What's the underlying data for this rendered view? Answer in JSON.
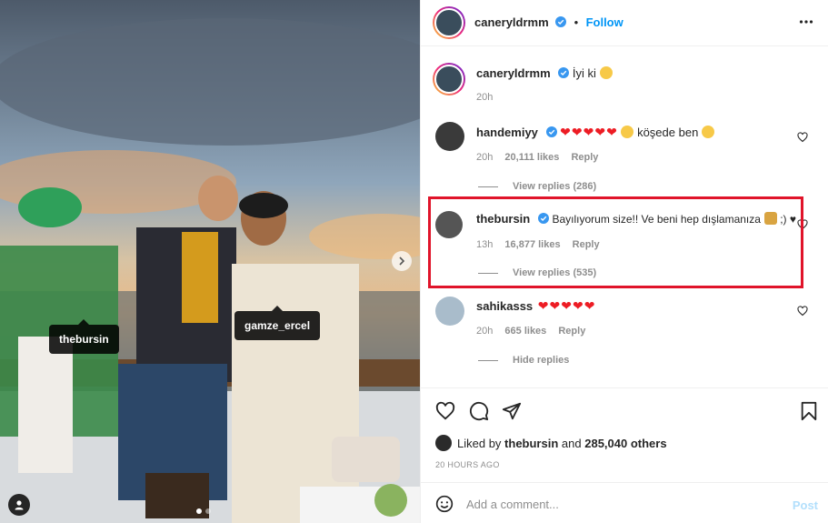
{
  "photo": {
    "tags": [
      "thebursin",
      "gamze_ercel"
    ],
    "icons": {
      "next": "chevron-right-icon",
      "user": "user-icon"
    },
    "carousel_index": 1,
    "carousel_count": 3
  },
  "header": {
    "username": "caneryldrmm",
    "follow_label": "Follow",
    "bullet": "•"
  },
  "caption": {
    "username": "caneryldrmm",
    "text": "İyi ki",
    "time": "20h"
  },
  "comments": [
    {
      "username": "handemiyy",
      "hearts": "❤❤❤❤❤",
      "text": "köşede ben",
      "time": "20h",
      "likes": "20,111 likes",
      "reply_label": "Reply",
      "replies_label": "View replies (286)"
    },
    {
      "username": "thebursin",
      "text": "Bayılıyorum size!! Ve beni hep dışlamanıza",
      "text_tail": ";) ♥",
      "time": "13h",
      "likes": "16,877 likes",
      "reply_label": "Reply",
      "replies_label": "View replies (535)"
    },
    {
      "username": "sahikasss",
      "hearts": "❤❤❤❤❤",
      "time": "20h",
      "likes": "665 likes",
      "reply_label": "Reply",
      "replies_label": "Hide replies"
    }
  ],
  "likes_line": {
    "prefix": "Liked by",
    "user": "thebursin",
    "middle": "and",
    "count": "285,040 others"
  },
  "time_ago": "20 HOURS AGO",
  "add_comment": {
    "placeholder": "Add a comment...",
    "post_label": "Post"
  },
  "colors": {
    "accent": "#0095f6",
    "highlight": "#e0142a",
    "heart": "#ed1c24",
    "post_disabled": "#b2dffc"
  }
}
